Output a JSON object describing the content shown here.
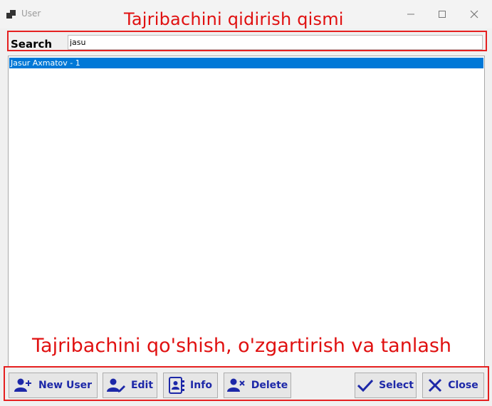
{
  "window": {
    "title": "User"
  },
  "annotations": {
    "top": "Tajribachini qidirish qismi",
    "bottom": "Tajribachini qo'shish, o'zgartirish va tanlash"
  },
  "search": {
    "label": "Search",
    "value": "jasu"
  },
  "list": {
    "items": [
      "Jasur Axmatov  - 1"
    ]
  },
  "buttons": {
    "new_user": "New User",
    "edit": "Edit",
    "info": "Info",
    "delete": "Delete",
    "select": "Select",
    "close": "Close"
  },
  "colors": {
    "accent": "#1d28a8",
    "selection": "#0078d7",
    "annotation": "#e01010"
  }
}
